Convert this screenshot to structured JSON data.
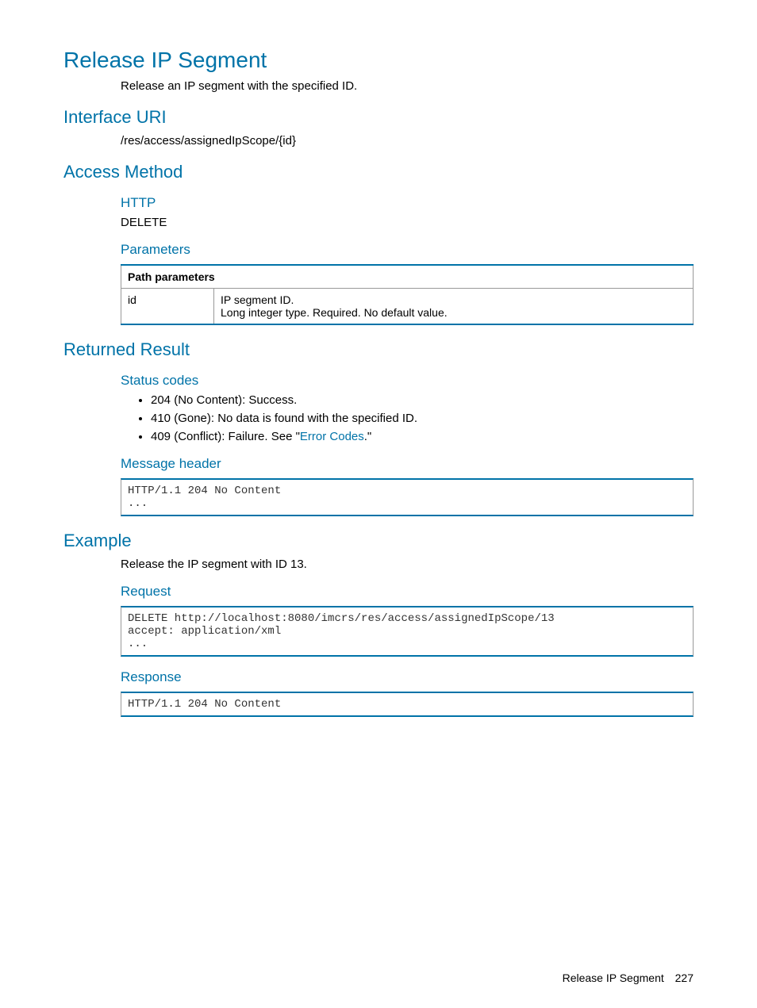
{
  "title": "Release IP Segment",
  "intro": "Release an IP segment with the specified ID.",
  "sections": {
    "interface_uri": {
      "heading": "Interface URI",
      "value": "/res/access/assignedIpScope/{id}"
    },
    "access_method": {
      "heading": "Access Method",
      "http_label": "HTTP",
      "http_value": "DELETE",
      "parameters_label": "Parameters",
      "table_header": "Path parameters",
      "param_name": "id",
      "param_desc_line1": "IP segment ID.",
      "param_desc_line2": "Long integer type. Required. No default value."
    },
    "returned_result": {
      "heading": "Returned Result",
      "status_codes_label": "Status codes",
      "status1": "204 (No Content): Success.",
      "status2": "410 (Gone): No data is found with the specified ID.",
      "status3_pre": "409 (Conflict): Failure. See \"",
      "status3_link": "Error Codes",
      "status3_post": ".\"",
      "message_header_label": "Message header",
      "message_header_code": "HTTP/1.1 204 No Content\n..."
    },
    "example": {
      "heading": "Example",
      "intro": "Release the IP segment with ID 13.",
      "request_label": "Request",
      "request_code": "DELETE http://localhost:8080/imcrs/res/access/assignedIpScope/13\naccept: application/xml\n...",
      "response_label": "Response",
      "response_code": "HTTP/1.1 204 No Content"
    }
  },
  "footer": {
    "title": "Release IP Segment",
    "page": "227"
  }
}
